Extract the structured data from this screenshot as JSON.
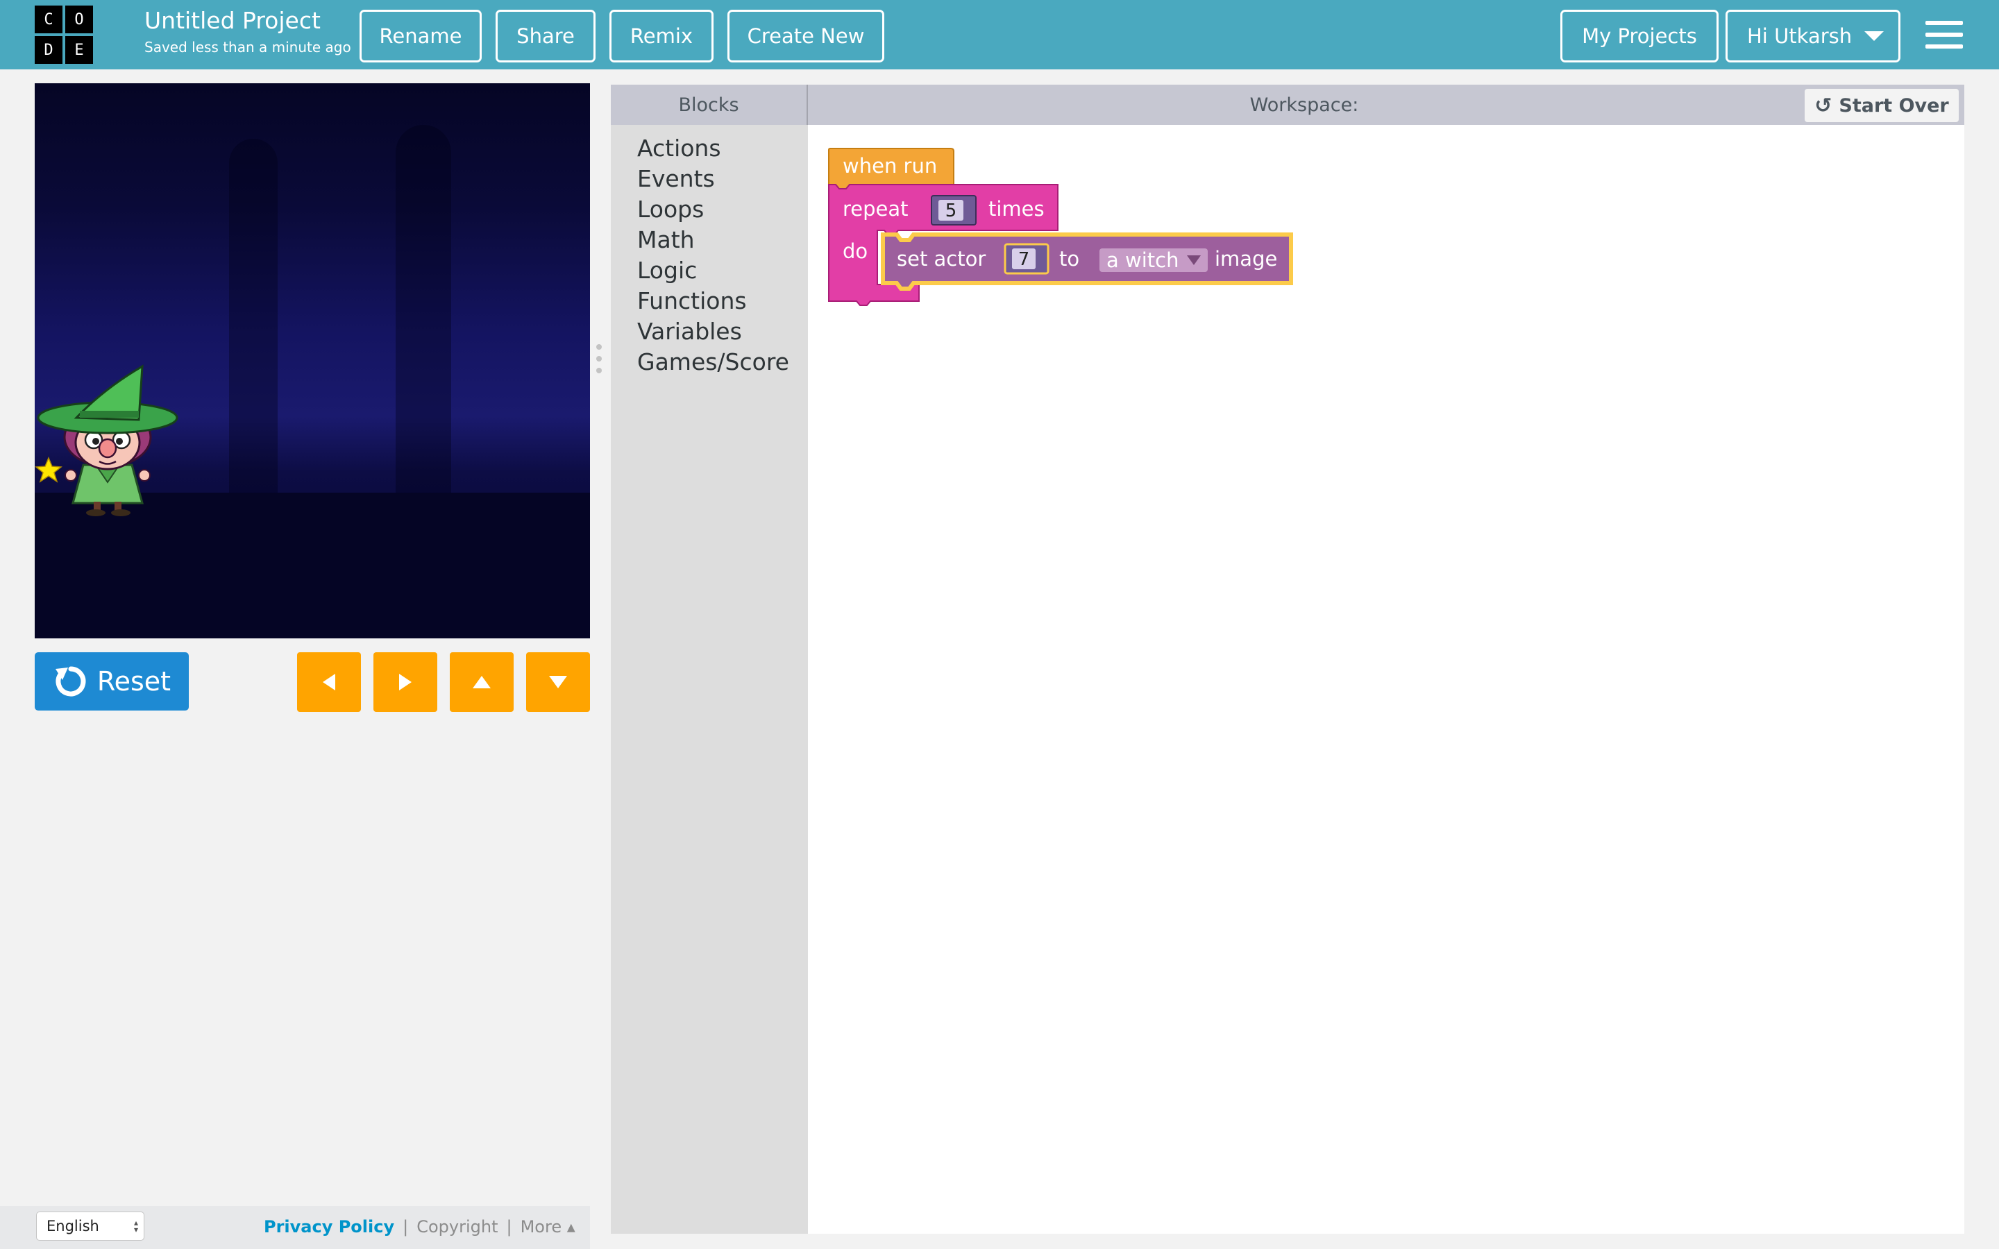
{
  "header": {
    "logo_letters": [
      "C",
      "O",
      "D",
      "E"
    ],
    "project_title": "Untitled Project",
    "save_status": "Saved less than a minute ago",
    "buttons": {
      "rename": "Rename",
      "share": "Share",
      "remix": "Remix",
      "create_new": "Create New"
    },
    "my_projects": "My Projects",
    "user_greeting": "Hi Utkarsh",
    "menu_icon": "hamburger-icon",
    "color": "#4aa9bf"
  },
  "stage": {
    "sprite": "witch",
    "background": "dark-forest-night",
    "colors": {
      "sky_top": "#050525",
      "sky_mid": "#1a1a6e",
      "witch_hat": "#3aa34a"
    }
  },
  "controls": {
    "reset_label": "Reset",
    "reset_icon": "reset-icon",
    "reset_color": "#1e8ad3",
    "arrow_color": "#ffa400",
    "arrows": [
      "left-arrow-icon",
      "right-arrow-icon",
      "up-arrow-icon",
      "down-arrow-icon"
    ]
  },
  "footer": {
    "language": "English",
    "links": {
      "privacy": "Privacy Policy",
      "copyright": "Copyright",
      "more": "More ▴"
    },
    "separator": "|"
  },
  "toolbox": {
    "header": "Blocks",
    "categories": [
      "Actions",
      "Events",
      "Loops",
      "Math",
      "Logic",
      "Functions",
      "Variables",
      "Games/Score"
    ]
  },
  "workspace": {
    "header": "Workspace:",
    "start_over": "Start Over",
    "start_over_icon": "undo-icon",
    "blocks": {
      "when_run": "when run",
      "repeat": "repeat",
      "repeat_count": "5",
      "times": "times",
      "do": "do",
      "set_actor": "set actor",
      "actor_number": "7",
      "to": "to",
      "image_choice": "a witch",
      "image": "image",
      "colors": {
        "event": "#f3a536",
        "loop": "#e23ea6",
        "action": "#9d5f9d",
        "value": "#6f5a96",
        "highlight": "#fccb4a"
      }
    }
  }
}
